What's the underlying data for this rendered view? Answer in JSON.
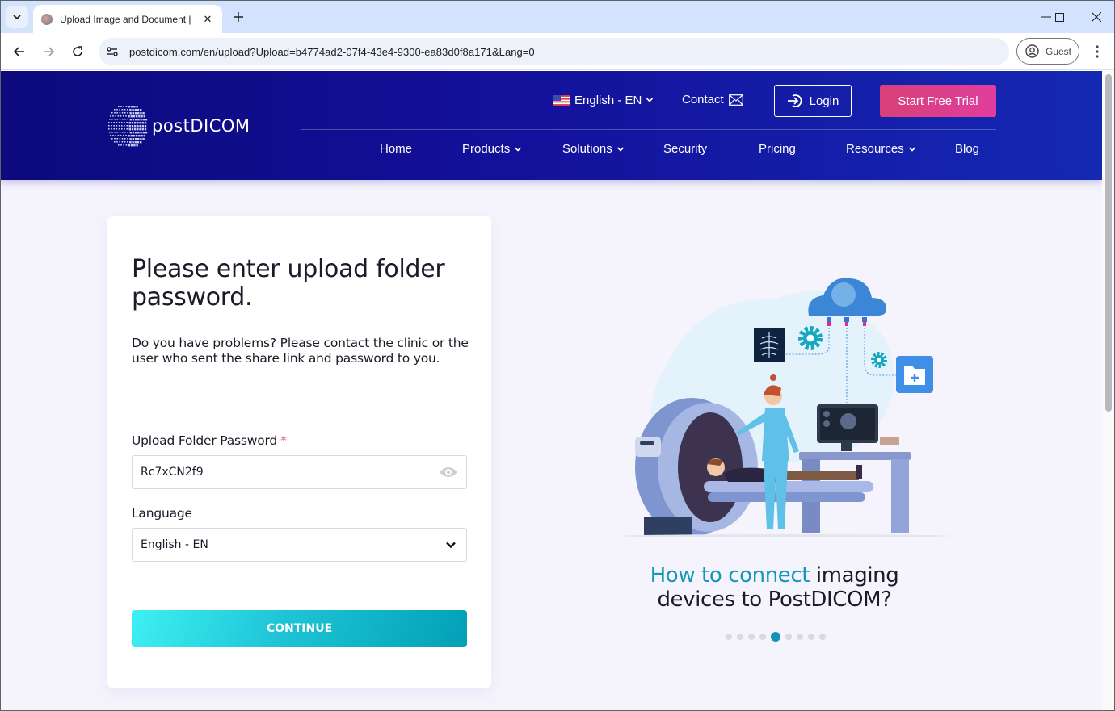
{
  "browser": {
    "tab": {
      "title": "Upload Image and Document |"
    },
    "url": "postdicom.com/en/upload?Upload=b4774ad2-07f4-43e4-9300-ea83d0f8a171&Lang=0",
    "profile_label": "Guest"
  },
  "header": {
    "logo_text": "postDICOM",
    "language": "English - EN",
    "contact_label": "Contact",
    "login_label": "Login",
    "trial_label": "Start Free Trial",
    "nav": [
      {
        "label": "Home",
        "has_dropdown": false
      },
      {
        "label": "Products",
        "has_dropdown": true
      },
      {
        "label": "Solutions",
        "has_dropdown": true
      },
      {
        "label": "Security",
        "has_dropdown": false
      },
      {
        "label": "Pricing",
        "has_dropdown": false
      },
      {
        "label": "Resources",
        "has_dropdown": true
      },
      {
        "label": "Blog",
        "has_dropdown": false
      }
    ],
    "colors": {
      "bg_start": "#0c0a7c",
      "bg_end": "#1529b3",
      "trial_button": "#dc3f8c"
    }
  },
  "form": {
    "title": "Please enter upload folder password.",
    "description": "Do you have problems? Please contact the clinic or the user who sent the share link and password to you.",
    "password_label": "Upload Folder Password",
    "required_marker": "*",
    "password_value": "Rc7xCN2f9",
    "language_label": "Language",
    "language_value": "English - EN",
    "continue_label": "CONTINUE",
    "colors": {
      "button": "#1ec4d6",
      "required": "#e8587a"
    }
  },
  "promo": {
    "caption_highlight": "How to connect",
    "caption_rest": " imaging devices to PostDICOM?",
    "carousel": {
      "total": 9,
      "active_index": 4
    },
    "colors": {
      "highlight": "#1697b8",
      "active_dot": "#1692b4"
    }
  }
}
